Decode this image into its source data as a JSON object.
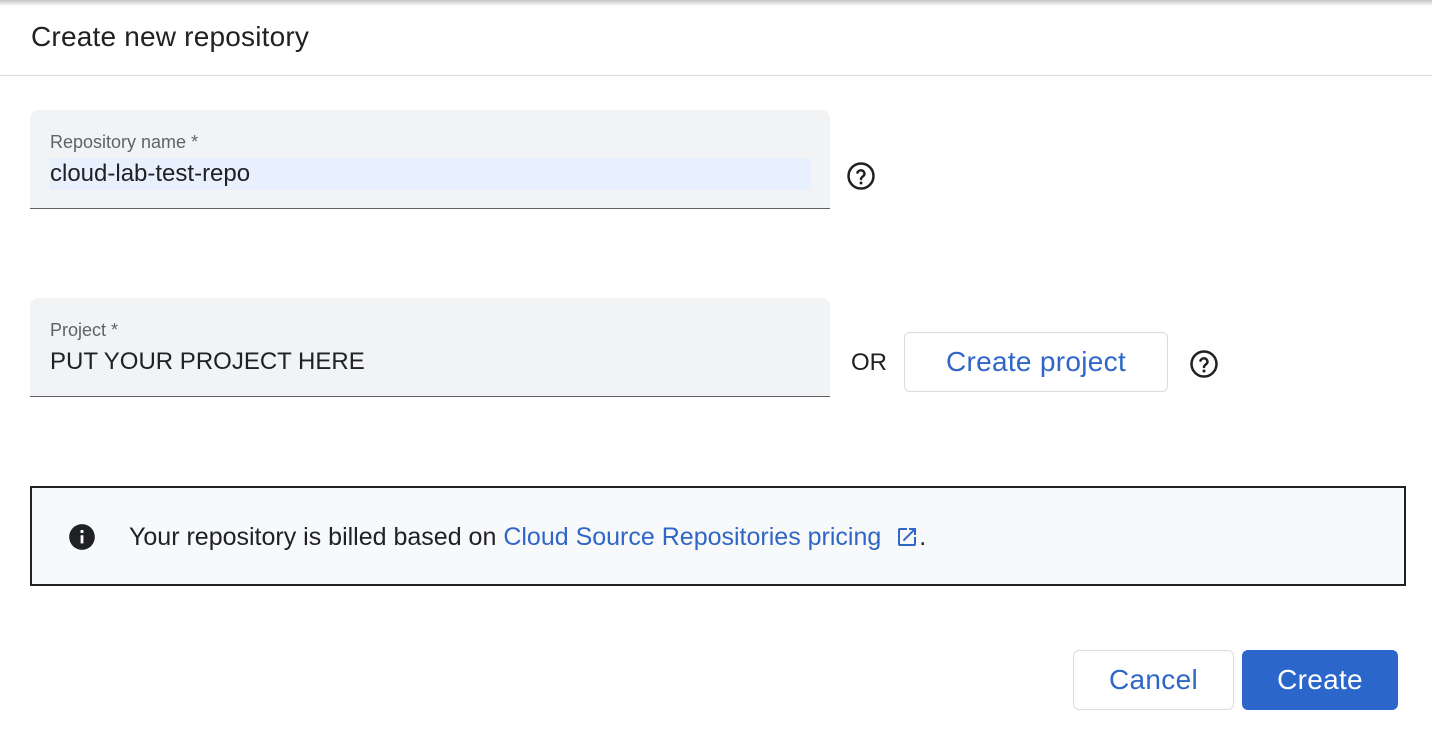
{
  "dialog": {
    "title": "Create new repository"
  },
  "repository": {
    "label": "Repository name *",
    "value": "cloud-lab-test-repo"
  },
  "project": {
    "label": "Project *",
    "value": "PUT YOUR PROJECT HERE",
    "or_text": "OR",
    "create_project_label": "Create project"
  },
  "info": {
    "text": "Your repository is billed based on ",
    "link_text": "Cloud Source Repositories pricing",
    "suffix": "."
  },
  "actions": {
    "cancel_label": "Cancel",
    "create_label": "Create"
  },
  "colors": {
    "accent": "#2b66cb",
    "link": "#2f66c7",
    "field_bg": "#f1f3f4",
    "info_bg": "#f8f9fa"
  },
  "icons": {
    "help": "help-circle-icon",
    "info": "info-icon",
    "external_link": "open-in-new-icon"
  }
}
